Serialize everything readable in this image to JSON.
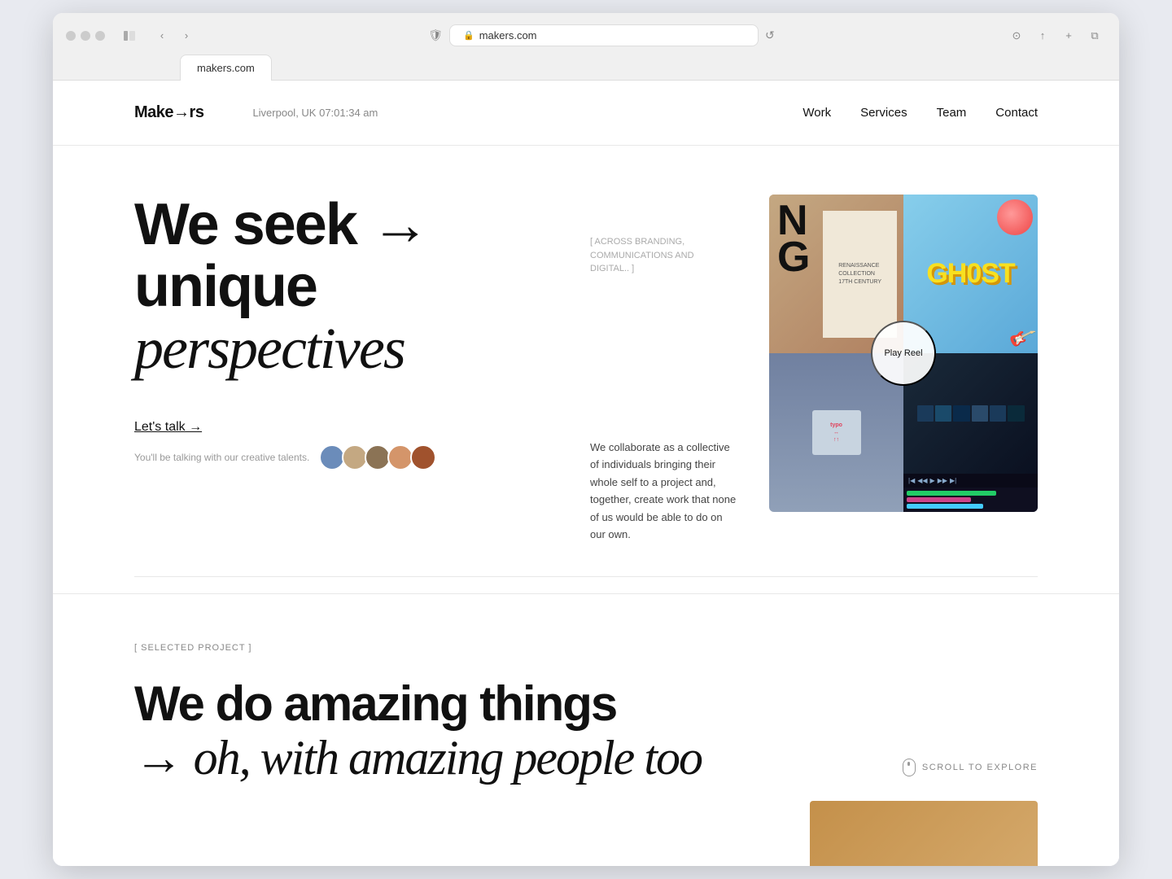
{
  "browser": {
    "url": "makers.com",
    "tab_label": "makers.com"
  },
  "header": {
    "logo": "Make→rs",
    "location_time": "Liverpool, UK 07:01:34 am",
    "nav": [
      {
        "label": "Work",
        "id": "work"
      },
      {
        "label": "Services",
        "id": "services"
      },
      {
        "label": "Team",
        "id": "team"
      },
      {
        "label": "Contact",
        "id": "contact"
      }
    ]
  },
  "hero": {
    "headline_line1": "We seek →",
    "headline_line2": "unique",
    "headline_line3": "perspectives",
    "tagline": "[ ACROSS BRANDING, COMMUNICATIONS AND DIGITAL.. ]",
    "cta_label": "Let's talk →",
    "talking_to": "You'll be talking with our creative talents.",
    "play_reel": "Play Reel",
    "description": "We collaborate as a collective of individuals bringing their whole self to a project and, together, create work that none of us would be able to do on our own."
  },
  "selected_project": {
    "section_label": "[ SELECTED PROJECT ]",
    "headline_line1": "We do amazing things",
    "headline_line2": "→ oh, with amazing people too",
    "scroll_label": "SCROLL TO EXPLORE"
  },
  "collage": {
    "cell1_letters": "NG",
    "cell2_ghost": "GH0ST",
    "cell3_tshirt_text": "typo ↔",
    "cell4_type": "video_editor"
  }
}
